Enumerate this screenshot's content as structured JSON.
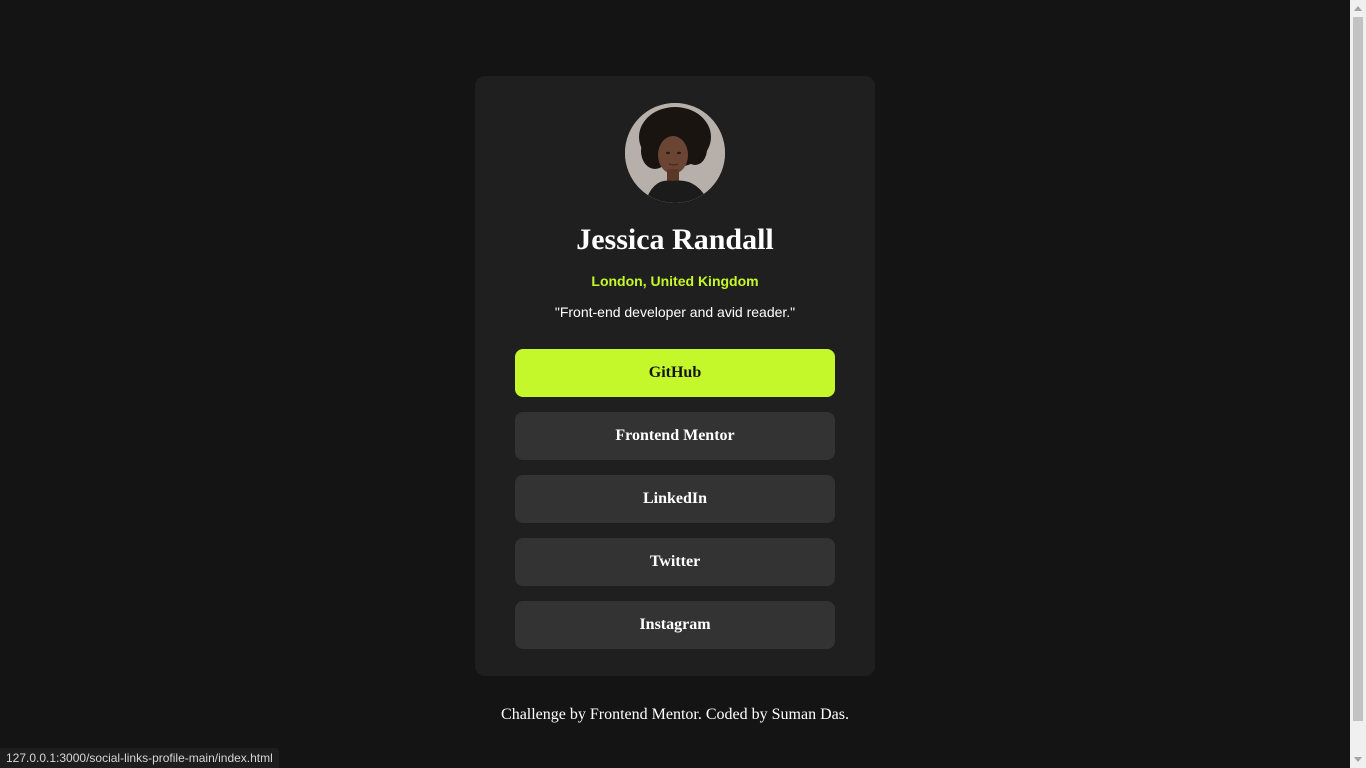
{
  "profile": {
    "name": "Jessica Randall",
    "location": "London, United Kingdom",
    "bio": "\"Front-end developer and avid reader.\""
  },
  "links": [
    {
      "label": "GitHub",
      "state": "hover"
    },
    {
      "label": "Frontend Mentor"
    },
    {
      "label": "LinkedIn"
    },
    {
      "label": "Twitter"
    },
    {
      "label": "Instagram"
    }
  ],
  "attribution": "Challenge by Frontend Mentor. Coded by Suman Das.",
  "status_bar": {
    "url": "127.0.0.1:3000/social-links-profile-main/index.html"
  },
  "colors": {
    "page_bg": "#141414",
    "card_bg": "#1f1f1f",
    "button_bg": "#333333",
    "accent": "#c4f82a",
    "text": "#ffffff"
  }
}
